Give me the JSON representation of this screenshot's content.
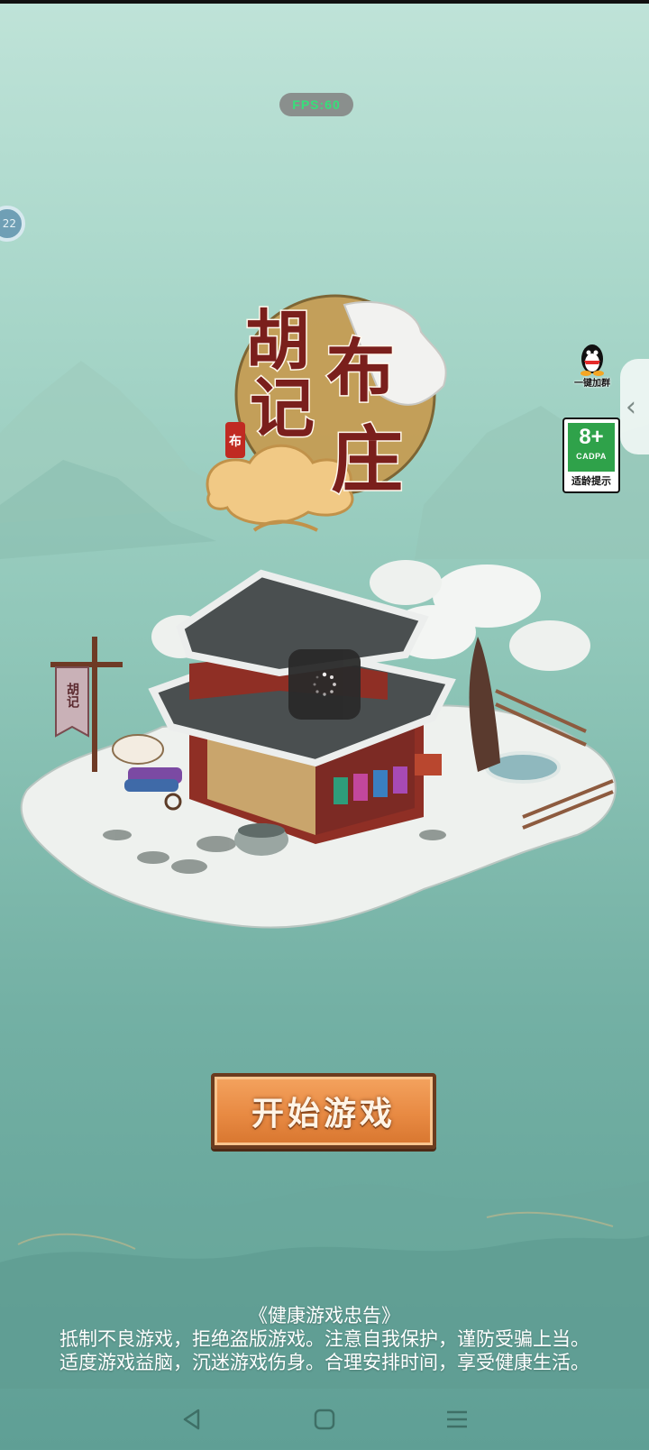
{
  "status": {
    "fps_label": "FPS:60"
  },
  "floating_ball": {
    "label": "22"
  },
  "logo": {
    "line1": "胡",
    "line2": "记",
    "line3": "布",
    "line4": "庄",
    "seal": "布"
  },
  "qq": {
    "label": "一键加群"
  },
  "age_rating": {
    "age": "8+",
    "org": "CADPA",
    "tip": "适龄提示"
  },
  "banner": {
    "text": "胡记"
  },
  "start_button": {
    "label": "开始游戏"
  },
  "notice": {
    "title": "《健康游戏忠告》",
    "line1": "抵制不良游戏，拒绝盗版游戏。注意自我保护，谨防受骗上当。",
    "line2": "适度游戏益脑，沉迷游戏伤身。合理安排时间，享受健康生活。"
  },
  "nav": {
    "back": "back-icon",
    "home": "home-icon",
    "menu": "menu-icon"
  },
  "colors": {
    "accent": "#e88a43",
    "logo_red": "#7a1f1c",
    "age_green": "#2fa24a"
  }
}
